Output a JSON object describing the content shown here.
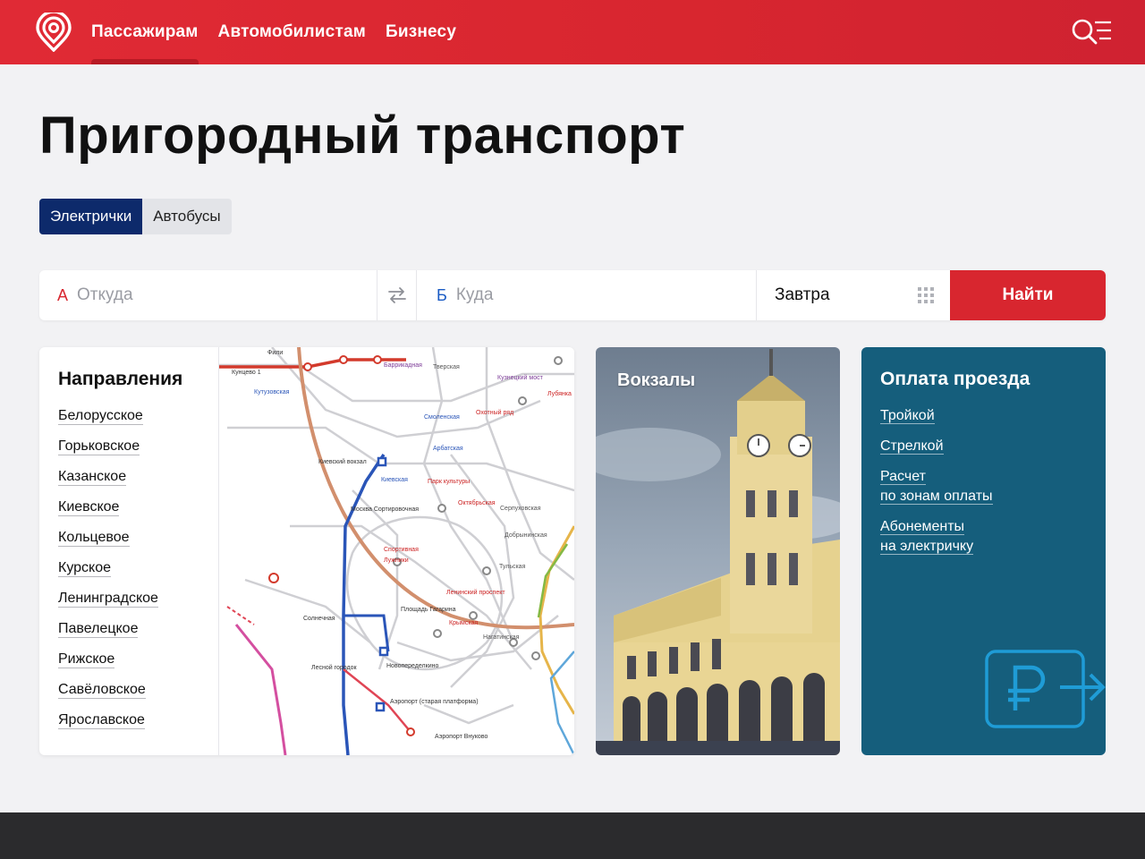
{
  "header": {
    "nav": [
      {
        "label": "Пассажирам"
      },
      {
        "label": "Автомобилистам"
      },
      {
        "label": "Бизнесу"
      }
    ],
    "brand_color": "#d8262f"
  },
  "page": {
    "title": "Пригородный транспорт"
  },
  "tabs": [
    {
      "label": "Электрички",
      "active": true
    },
    {
      "label": "Автобусы",
      "active": false
    }
  ],
  "search": {
    "from_letter": "А",
    "from_placeholder": "Откуда",
    "to_letter": "Б",
    "to_placeholder": "Куда",
    "date": "Завтра",
    "submit": "Найти"
  },
  "directions": {
    "title": "Направления",
    "items": [
      "Белорусское",
      "Горьковское",
      "Казанское",
      "Киевское",
      "Кольцевое",
      "Курское",
      "Ленинградское",
      "Павелецкое",
      "Рижское",
      "Савёловское",
      "Ярославское"
    ]
  },
  "stations": {
    "title": "Вокзалы"
  },
  "payment": {
    "title": "Оплата проезда",
    "links": [
      {
        "line1": "Тройкой",
        "line2": ""
      },
      {
        "line1": "Стрелкой",
        "line2": ""
      },
      {
        "line1": "Расчет",
        "line2": "по зонам оплаты"
      },
      {
        "line1": "Абонементы",
        "line2": "на электричку"
      }
    ]
  },
  "map_labels": [
    "Фили",
    "Кутузовская",
    "Киевский вокзал",
    "Киевская",
    "Смоленская",
    "Арбатская",
    "Охотный ряд",
    "Тверская",
    "Баррикадная",
    "Кузнецкий мост",
    "Лубянка",
    "Парк культуры",
    "Октябрьская",
    "Серпуховская",
    "Добрынинская",
    "Тульская",
    "Спортивная",
    "Лужники",
    "Москва Сортировочная",
    "Площадь Гагарина",
    "Крымская",
    "Ленинский проспект",
    "Новопеределкино",
    "Солнечная",
    "Лесной городок",
    "Аэропорт (старая платформа)",
    "Аэропорт Внуково",
    "Нагатинская",
    "Кунцево 1"
  ]
}
